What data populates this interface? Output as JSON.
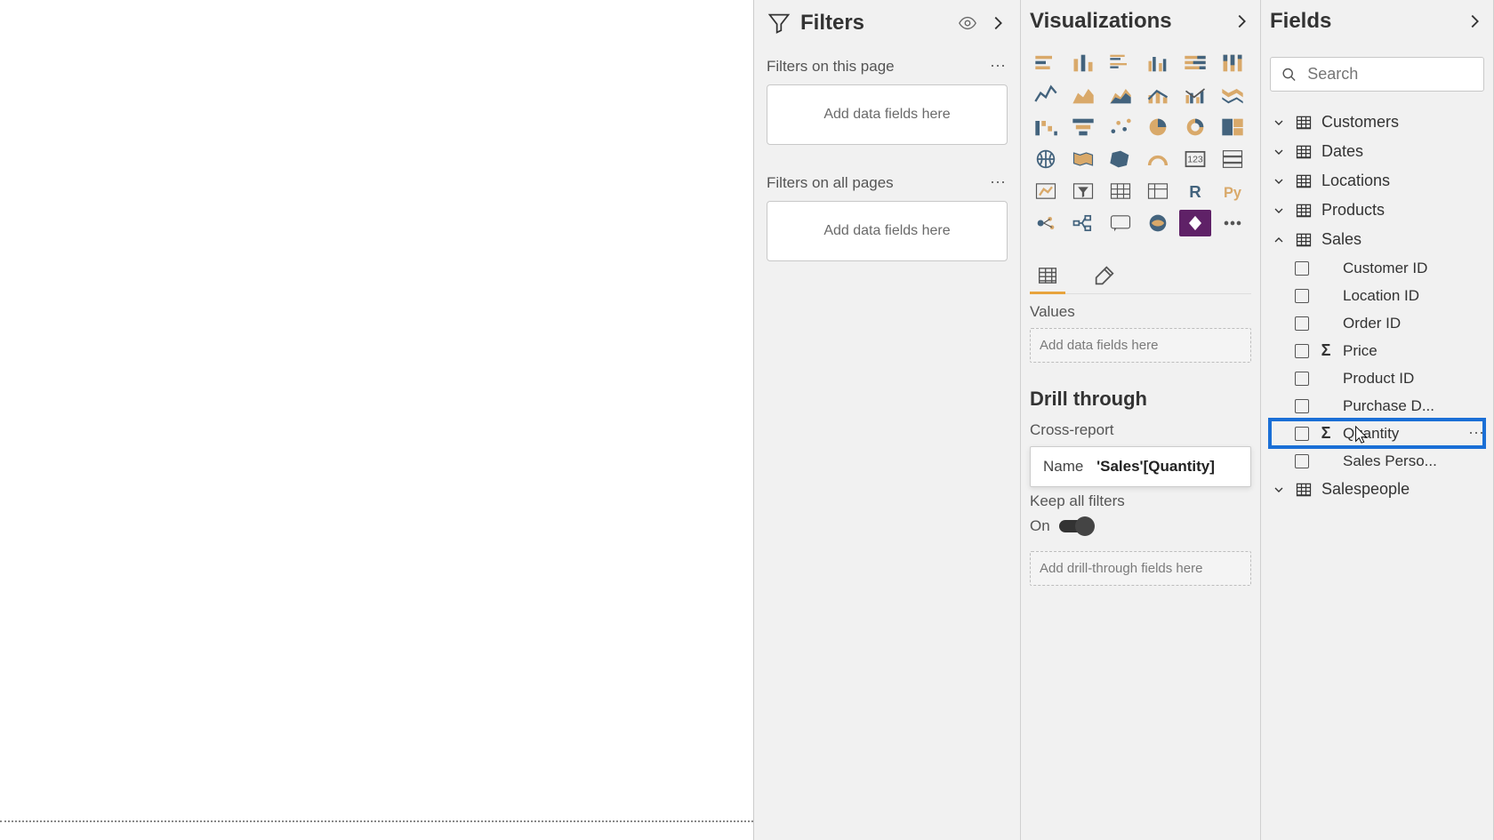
{
  "filters": {
    "title": "Filters",
    "page_label": "Filters on this page",
    "all_label": "Filters on all pages",
    "dropzone": "Add data fields here"
  },
  "viz": {
    "title": "Visualizations",
    "values_label": "Values",
    "values_drop": "Add data fields here",
    "drill_title": "Drill through",
    "cross_report": "Cross-report",
    "keep_filters": "Keep all filters",
    "keep_on": "On",
    "drill_drop": "Add drill-through fields here",
    "tooltip_name": "Name",
    "tooltip_value": "'Sales'[Quantity]"
  },
  "fields": {
    "title": "Fields",
    "search_placeholder": "Search",
    "tables": [
      {
        "name": "Customers",
        "expanded": false
      },
      {
        "name": "Dates",
        "expanded": false
      },
      {
        "name": "Locations",
        "expanded": false
      },
      {
        "name": "Products",
        "expanded": false
      },
      {
        "name": "Sales",
        "expanded": true
      },
      {
        "name": "Salespeople",
        "expanded": false
      }
    ],
    "sales_fields": [
      {
        "label": "Customer ID",
        "sigma": false,
        "highlight": false
      },
      {
        "label": "Location ID",
        "sigma": false,
        "highlight": false
      },
      {
        "label": "Order ID",
        "sigma": false,
        "highlight": false
      },
      {
        "label": "Price",
        "sigma": true,
        "highlight": false
      },
      {
        "label": "Product ID",
        "sigma": false,
        "highlight": false
      },
      {
        "label": "Purchase D...",
        "sigma": false,
        "highlight": false
      },
      {
        "label": "Quantity",
        "sigma": true,
        "highlight": true
      },
      {
        "label": "Sales Perso...",
        "sigma": false,
        "highlight": false
      }
    ]
  }
}
